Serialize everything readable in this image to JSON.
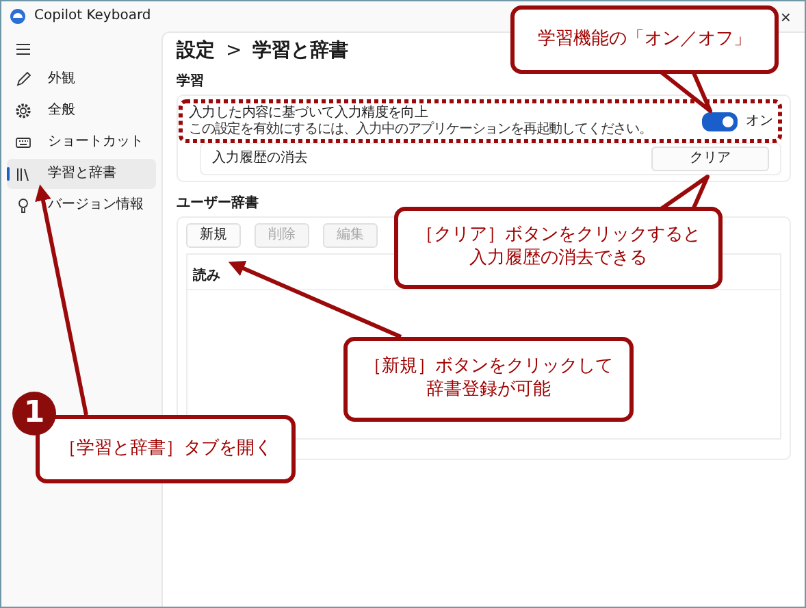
{
  "window": {
    "title": "Copilot Keyboard",
    "close": "×"
  },
  "sidebar": {
    "items": [
      {
        "label": "外観",
        "kind": "pencil",
        "selected": false
      },
      {
        "label": "全般",
        "kind": "gear",
        "selected": false
      },
      {
        "label": "ショートカット",
        "kind": "keyboard",
        "selected": false
      },
      {
        "label": "学習と辞書",
        "kind": "books",
        "selected": true
      },
      {
        "label": "バージョン情報",
        "kind": "bulb",
        "selected": false
      }
    ]
  },
  "header": {
    "parent": "設定",
    "separator": ">",
    "current": "学習と辞書"
  },
  "learning": {
    "heading": "学習",
    "setting": {
      "title": "入力した内容に基づいて入力精度を向上",
      "description": "この設定を有効にするには、入力中のアプリケーションを再起動してください。",
      "on": true,
      "state_label": "オン"
    },
    "clear": {
      "label": "入力履歴の消去",
      "button": "クリア"
    }
  },
  "dictionary": {
    "heading": "ユーザー辞書",
    "buttons": [
      {
        "label": "新規",
        "disabled": false
      },
      {
        "label": "削除",
        "disabled": true
      },
      {
        "label": "編集",
        "disabled": true
      }
    ],
    "table": {
      "columns": [
        "読み"
      ]
    }
  },
  "annotations": {
    "step_number": "1",
    "callouts": [
      {
        "lines": [
          "学習機能の「オン／オフ」"
        ]
      },
      {
        "lines": [
          "［クリア］ボタンをクリックすると",
          "入力履歴の消去できる"
        ]
      },
      {
        "lines": [
          "［新規］ボタンをクリックして",
          "辞書登録が可能"
        ]
      },
      {
        "lines": [
          "［学習と辞書］タブを開く"
        ]
      }
    ]
  }
}
